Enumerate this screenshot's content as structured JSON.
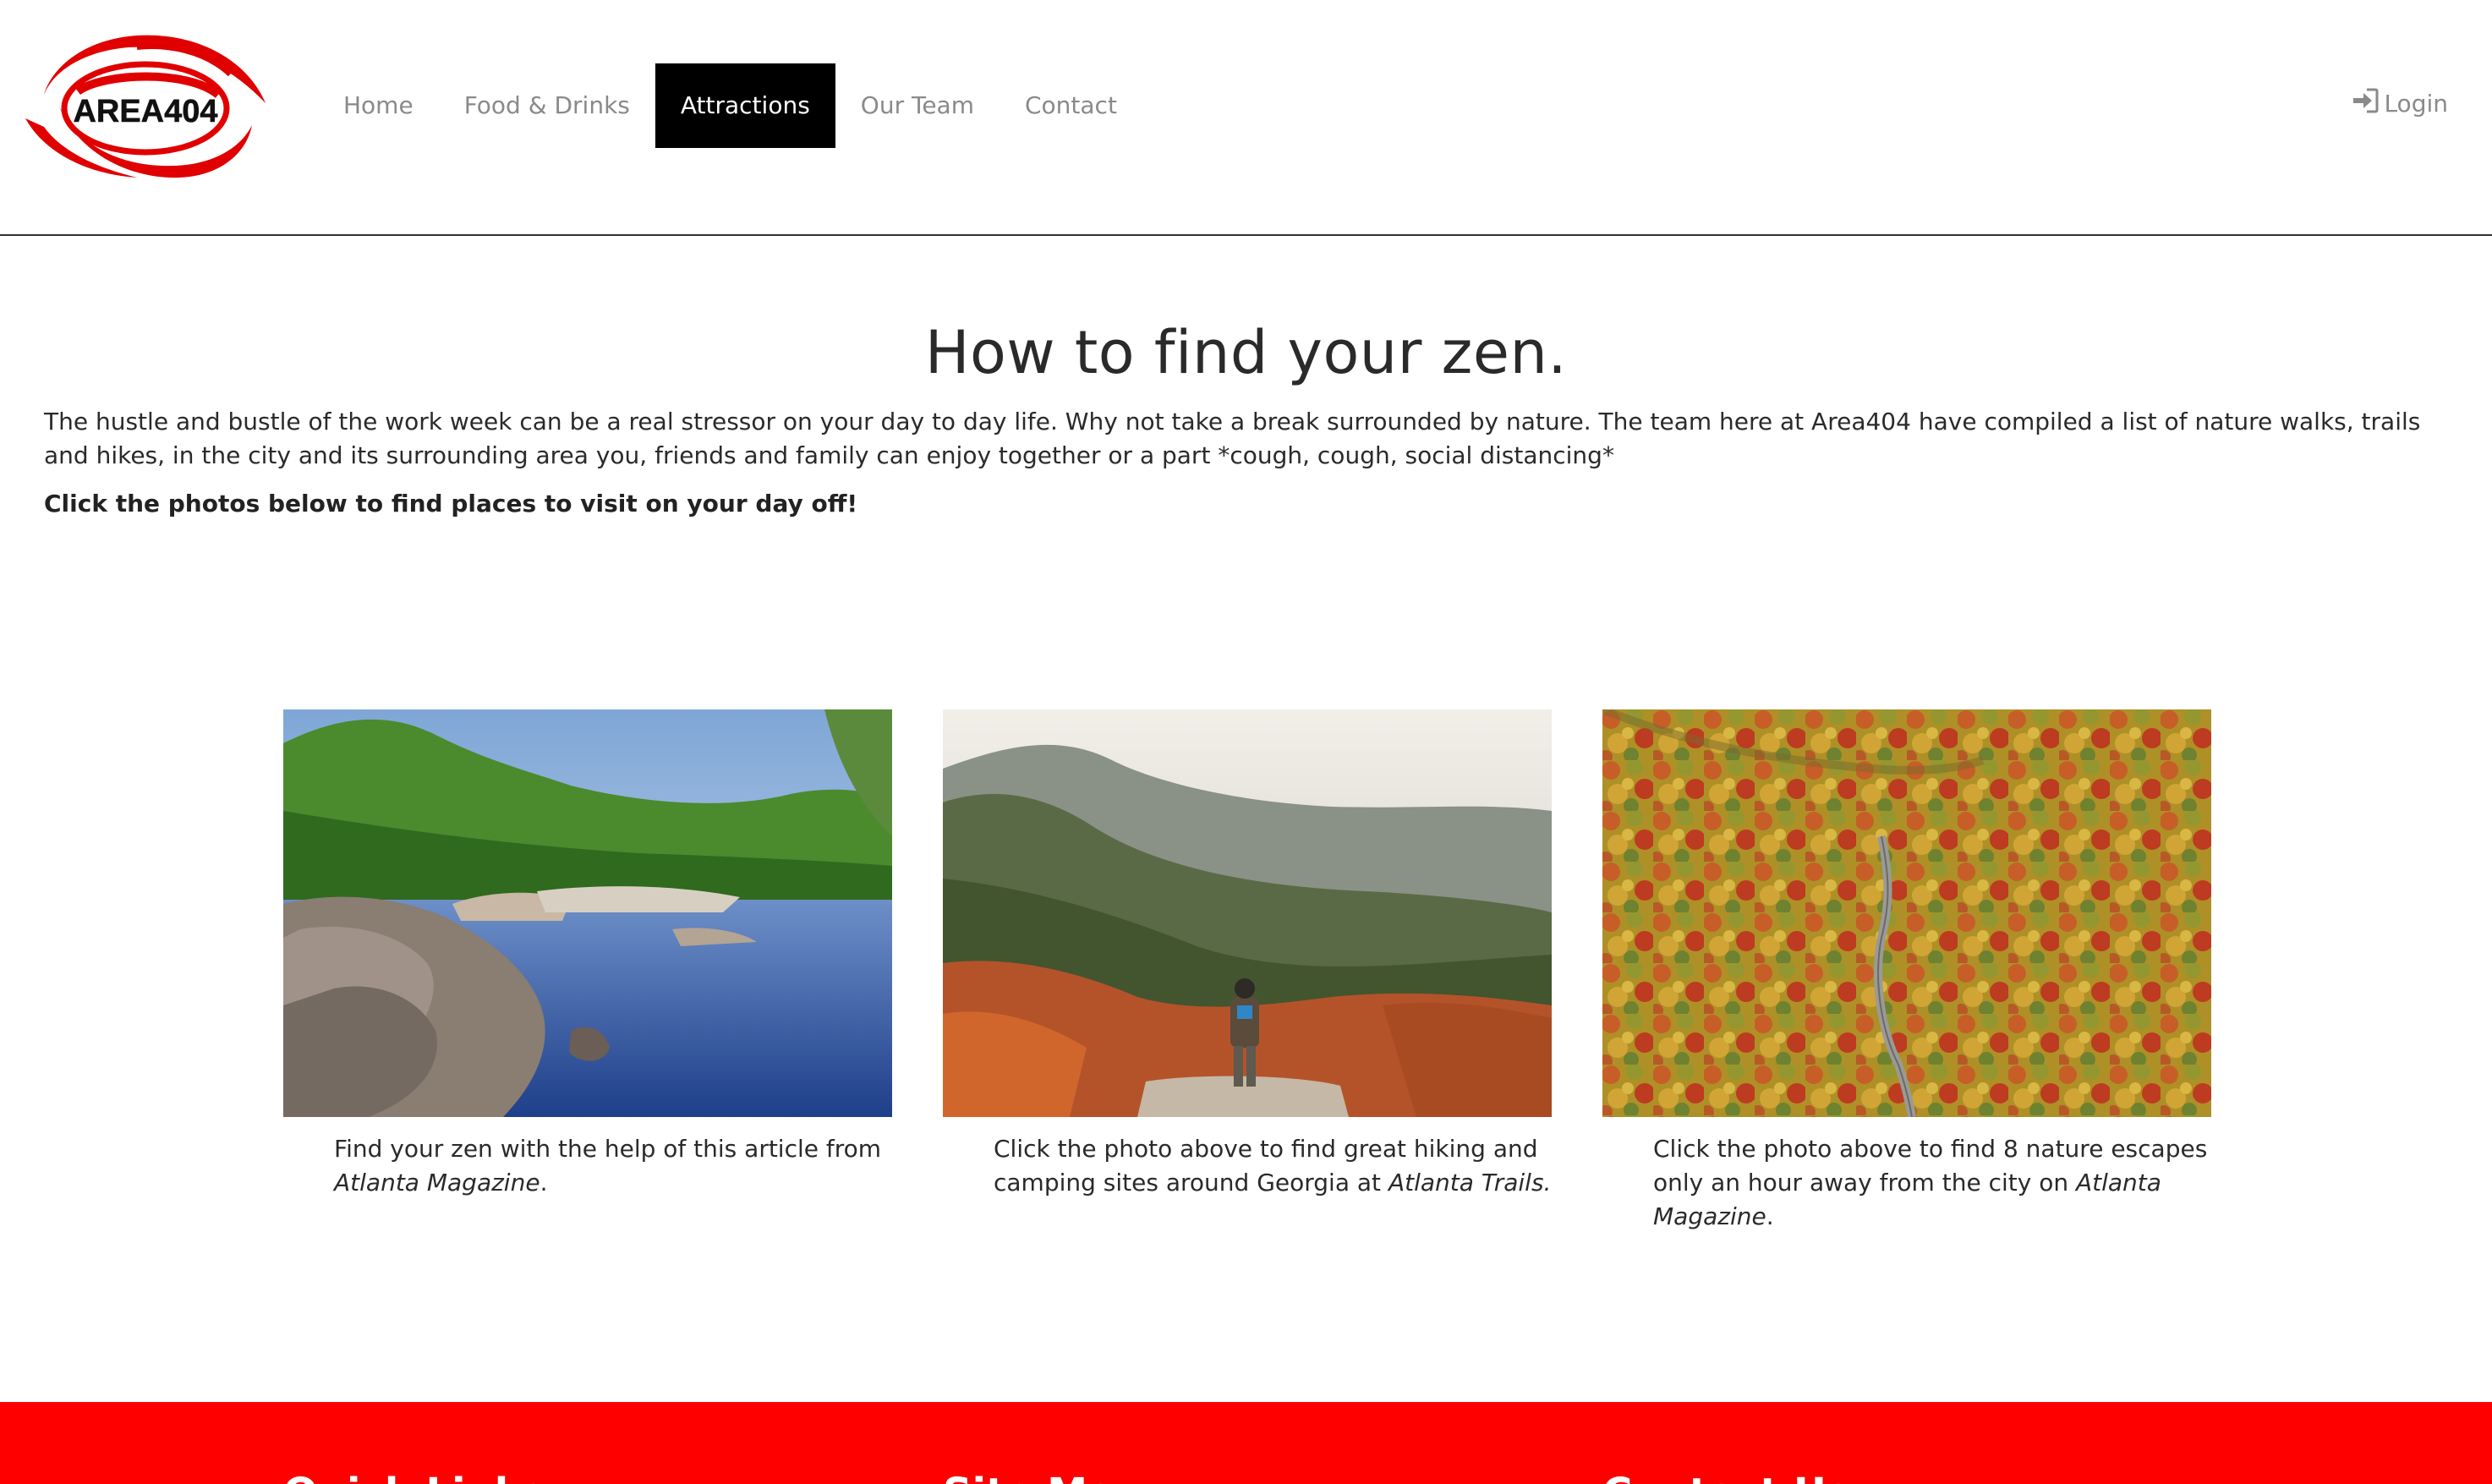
{
  "brand": {
    "logo_text": "AREA404",
    "accent_color": "#fe0000"
  },
  "nav": {
    "items": [
      {
        "label": "Home",
        "active": false
      },
      {
        "label": "Food & Drinks",
        "active": false
      },
      {
        "label": "Attractions",
        "active": true
      },
      {
        "label": "Our Team",
        "active": false
      },
      {
        "label": "Contact",
        "active": false
      }
    ],
    "login_label": "Login",
    "login_icon": "sign-in-icon"
  },
  "main": {
    "title": "How to find your zen.",
    "intro": "The hustle and bustle of the work week can be a real stressor on your day to day life. Why not take a break surrounded by nature. The team here at Area404 have compiled a list of nature walks, trails and hikes, in the city and its surrounding area you, friends and family can enjoy together or a part *cough, cough, social distancing*",
    "cta": "Click the photos below to find places to visit on your day off!",
    "cards": [
      {
        "photo": "river-rocks-photo",
        "caption_before": "Find your zen with the help of this article from ",
        "caption_source": "Atlanta Magazine",
        "caption_after": "."
      },
      {
        "photo": "mountain-hiker-photo",
        "caption_before": "Click the photo above to find great hiking and camping sites around Georgia at ",
        "caption_source": "Atlanta Trails.",
        "caption_after": ""
      },
      {
        "photo": "autumn-forest-road-photo",
        "caption_before": "Click the photo above to find 8 nature escapes only an hour away from the city on ",
        "caption_source": "Atlanta Magazine",
        "caption_after": "."
      }
    ]
  },
  "footer": {
    "headings": [
      "Quick Links",
      "Site Map",
      "Contact Us"
    ]
  }
}
